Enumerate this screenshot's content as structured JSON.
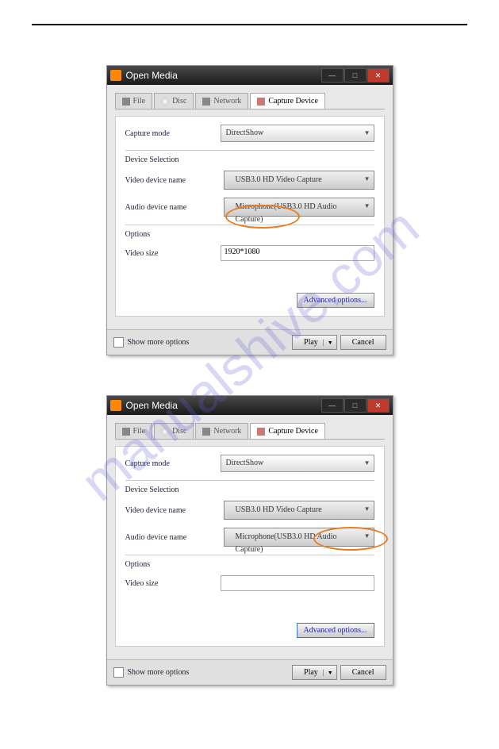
{
  "watermark": "manualshive.com",
  "dialog1": {
    "title": "Open Media",
    "tabs": {
      "file": "File",
      "disc": "Disc",
      "network": "Network",
      "capture": "Capture Device"
    },
    "capture_mode_label": "Capture mode",
    "capture_mode_value": "DirectShow",
    "device_selection": "Device Selection",
    "video_device_label": "Video device name",
    "video_device_value": "USB3.0 HD Video Capture",
    "audio_device_label": "Audio device name",
    "audio_device_value": "Microphone(USB3.0 HD Audio Capture)",
    "options": "Options",
    "video_size_label": "Video size",
    "video_size_value": "1920*1080",
    "advanced": "Advanced options...",
    "show_more": "Show more options",
    "play": "Play",
    "cancel": "Cancel"
  },
  "dialog2": {
    "title": "Open Media",
    "tabs": {
      "file": "File",
      "disc": "Disc",
      "network": "Network",
      "capture": "Capture Device"
    },
    "capture_mode_label": "Capture mode",
    "capture_mode_value": "DirectShow",
    "device_selection": "Device Selection",
    "video_device_label": "Video device name",
    "video_device_value": "USB3.0 HD Video Capture",
    "audio_device_label": "Audio device name",
    "audio_device_value": "Microphone(USB3.0 HD Audio Capture)",
    "options": "Options",
    "video_size_label": "Video size",
    "video_size_value": "",
    "advanced": "Advanced options...",
    "show_more": "Show more options",
    "play": "Play",
    "cancel": "Cancel"
  }
}
